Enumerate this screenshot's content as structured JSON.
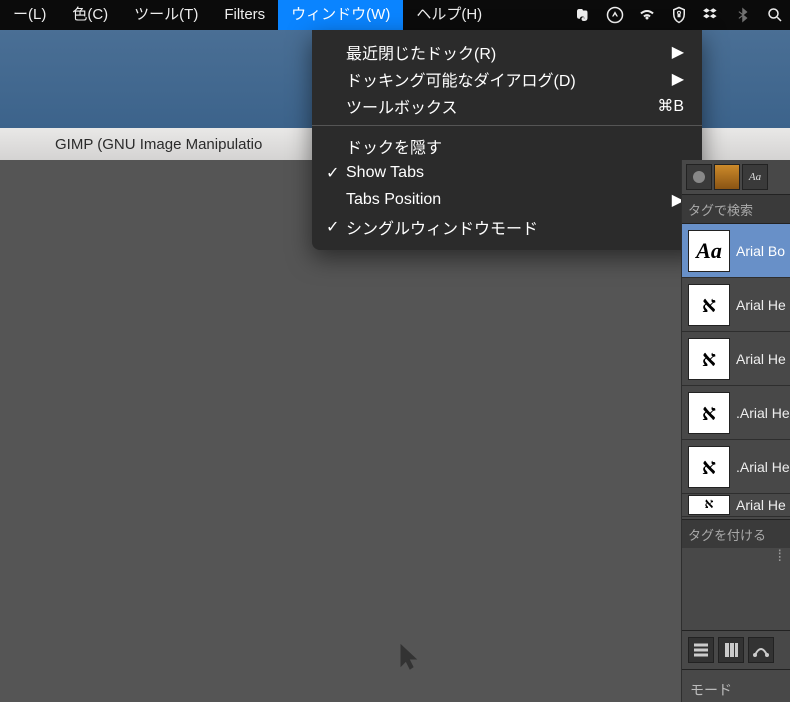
{
  "menubar": {
    "items": [
      {
        "label": "ー(L)"
      },
      {
        "label": "色(C)"
      },
      {
        "label": "ツール(T)"
      },
      {
        "label": "Filters"
      },
      {
        "label": "ウィンドウ(W)",
        "active": true
      },
      {
        "label": "ヘルプ(H)"
      }
    ],
    "sysicons": [
      "evernote-icon",
      "avast-icon",
      "wifi-icon",
      "vpn-icon",
      "dropbox-icon",
      "bluetooth-icon",
      "spotlight-icon"
    ]
  },
  "titlebar": {
    "text": "GIMP (GNU Image Manipulatio"
  },
  "dropdown": {
    "items": [
      {
        "label": "最近閉じたドック(R)",
        "submenu": true
      },
      {
        "label": "ドッキング可能なダイアログ(D)",
        "submenu": true
      },
      {
        "label": "ツールボックス",
        "accel": "⌘B"
      },
      {
        "sep": true
      },
      {
        "label": "ドックを隠す"
      },
      {
        "label": "Show Tabs",
        "checked": true
      },
      {
        "label": "Tabs Position",
        "submenu": true
      },
      {
        "label": "シングルウィンドウモード",
        "checked": true
      }
    ]
  },
  "fonts": {
    "filter_placeholder": "タグで検索",
    "tag_placeholder": "タグを付ける",
    "list": [
      {
        "glyph": "Aa",
        "glyph_class": "aa",
        "name": "Arial Bo",
        "selected": true
      },
      {
        "glyph": "א",
        "glyph_class": "alef",
        "name": "Arial He"
      },
      {
        "glyph": "א",
        "glyph_class": "alef",
        "name": "Arial He"
      },
      {
        "glyph": "א",
        "glyph_class": "alef",
        "name": ".Arial He"
      },
      {
        "glyph": "א",
        "glyph_class": "alef",
        "name": ".Arial He"
      },
      {
        "glyph": "א",
        "glyph_class": "alef",
        "name": "Arial He",
        "half": true
      }
    ],
    "tabs": [
      {
        "name": "brushes-tab"
      },
      {
        "name": "patterns-tab"
      },
      {
        "name": "fonts-tab",
        "text": "Aa",
        "active": true
      }
    ]
  },
  "dock": {
    "tabs": [
      "layers-tab",
      "channels-tab",
      "paths-tab"
    ],
    "mode_label": "モード"
  }
}
